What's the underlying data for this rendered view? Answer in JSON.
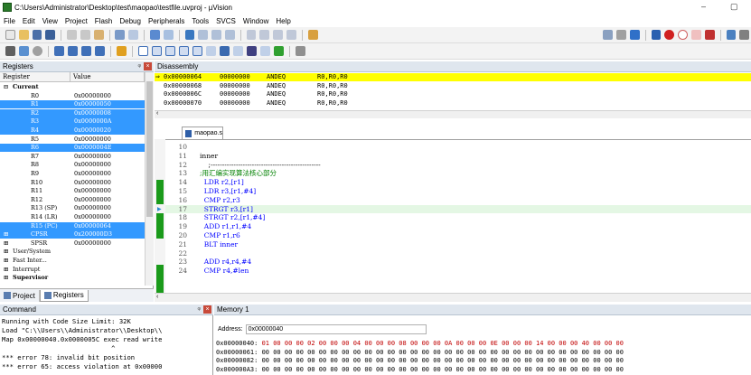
{
  "window": {
    "title": "C:\\Users\\Administrator\\Desktop\\test\\maopao\\testfile.uvproj - µVision",
    "minimize": "–",
    "restore": "▢"
  },
  "menu": [
    "File",
    "Edit",
    "View",
    "Project",
    "Flash",
    "Debug",
    "Peripherals",
    "Tools",
    "SVCS",
    "Window",
    "Help"
  ],
  "registers": {
    "header": "Registers",
    "col_register": "Register",
    "col_value": "Value",
    "rows": [
      {
        "tree": "⊟",
        "name": "Current",
        "value": "",
        "selected": false,
        "bold": true
      },
      {
        "tree": "",
        "name": "R0",
        "value": "0x00000000",
        "selected": false
      },
      {
        "tree": "",
        "name": "R1",
        "value": "0x00000050",
        "selected": true
      },
      {
        "tree": "",
        "name": "R2",
        "value": "0x00000008",
        "selected": true
      },
      {
        "tree": "",
        "name": "R3",
        "value": "0x0000000A",
        "selected": true
      },
      {
        "tree": "",
        "name": "R4",
        "value": "0x00000020",
        "selected": true
      },
      {
        "tree": "",
        "name": "R5",
        "value": "0x00000000",
        "selected": false
      },
      {
        "tree": "",
        "name": "R6",
        "value": "0x0000004E",
        "selected": true
      },
      {
        "tree": "",
        "name": "R7",
        "value": "0x00000000",
        "selected": false
      },
      {
        "tree": "",
        "name": "R8",
        "value": "0x00000000",
        "selected": false
      },
      {
        "tree": "",
        "name": "R9",
        "value": "0x00000000",
        "selected": false
      },
      {
        "tree": "",
        "name": "R10",
        "value": "0x00000000",
        "selected": false
      },
      {
        "tree": "",
        "name": "R11",
        "value": "0x00000000",
        "selected": false
      },
      {
        "tree": "",
        "name": "R12",
        "value": "0x00000000",
        "selected": false
      },
      {
        "tree": "",
        "name": "R13 (SP)",
        "value": "0x00000000",
        "selected": false
      },
      {
        "tree": "",
        "name": "R14 (LR)",
        "value": "0x00000000",
        "selected": false
      },
      {
        "tree": "",
        "name": "R15 (PC)",
        "value": "0x00000064",
        "selected": true
      },
      {
        "tree": "⊞",
        "name": "CPSR",
        "value": "0x200000D3",
        "selected": true
      },
      {
        "tree": "⊞",
        "name": "SPSR",
        "value": "0x00000000",
        "selected": false
      },
      {
        "tree": "⊞",
        "name": "User/System",
        "value": "",
        "selected": false,
        "indent": 0
      },
      {
        "tree": "⊞",
        "name": "Fast Inter...",
        "value": "",
        "selected": false,
        "indent": 0
      },
      {
        "tree": "⊞",
        "name": "Interrupt",
        "value": "",
        "selected": false,
        "indent": 0
      },
      {
        "tree": "⊞",
        "name": "Supervisor",
        "value": "",
        "selected": false,
        "indent": 0,
        "bold": true
      }
    ],
    "tabs": [
      "Project",
      "Registers"
    ]
  },
  "disassembly": {
    "header": "Disassembly",
    "lines": [
      {
        "addr": "0x00000064",
        "op": "00000000",
        "mn": "ANDEQ",
        "args": "R0,R0,R0",
        "current": true
      },
      {
        "addr": "0x00000068",
        "op": "00000000",
        "mn": "ANDEQ",
        "args": "R0,R0,R0",
        "current": false
      },
      {
        "addr": "0x0000006C",
        "op": "00000000",
        "mn": "ANDEQ",
        "args": "R0,R0,R0",
        "current": false
      },
      {
        "addr": "0x00000070",
        "op": "00000000",
        "mn": "ANDEQ",
        "args": "R0,R0,R0",
        "current": false
      }
    ]
  },
  "editor": {
    "tab": "maopao.s",
    "lines": [
      {
        "n": "10",
        "code": ""
      },
      {
        "n": "11",
        "code": "inner"
      },
      {
        "n": "12",
        "code": "    ;------------------------------------------------"
      },
      {
        "n": "13",
        "code": ";用汇编实现算法核心部分",
        "comment": true
      },
      {
        "n": "14",
        "code": "  LDR r2,[r1]"
      },
      {
        "n": "15",
        "code": "  LDR r3,[r1,#4]"
      },
      {
        "n": "16",
        "code": "  CMP r2,r3"
      },
      {
        "n": "17",
        "code": "  STRGT r3,[r1]",
        "hl": true
      },
      {
        "n": "18",
        "code": "  STRGT r2,[r1,#4]"
      },
      {
        "n": "19",
        "code": "  ADD r1,r1,#4"
      },
      {
        "n": "20",
        "code": "  CMP r1,r6"
      },
      {
        "n": "21",
        "code": "  BLT inner"
      },
      {
        "n": "22",
        "code": ""
      },
      {
        "n": "23",
        "code": "  ADD r4,r4,#4"
      },
      {
        "n": "24",
        "code": "  CMP r4,#len"
      }
    ]
  },
  "command": {
    "header": "Command",
    "lines": [
      "Running with Code Size Limit: 32K",
      "Load \"C:\\\\Users\\\\Administrator\\\\Desktop\\\\",
      "Map 0x00000040.0x0000005C exec read write",
      "                            ^",
      "*** error 78: invalid bit position",
      "*** error 65: access violation at 0x00000"
    ]
  },
  "memory": {
    "header": "Memory 1",
    "address_label": "Address:",
    "address_value": "0x00000040",
    "lines": [
      {
        "addr": "0x00000040:",
        "bytes": "01 00 00 00 02 00 00 00 04 00 00 00 08 00 00 00 0A 00 00 00 0E 00 00 00 14 00 00 00 40 00 00 00",
        "red": true
      },
      {
        "addr": "0x00000061:",
        "bytes": "00 00 00 00 00 00 00 00 00 00 00 00 00 00 00 00 00 00 00 00 00 00 00 00 00 00 00 00 00 00 00 00",
        "red": false
      },
      {
        "addr": "0x00000082:",
        "bytes": "00 00 00 00 00 00 00 00 00 00 00 00 00 00 00 00 00 00 00 00 00 00 00 00 00 00 00 00 00 00 00 00",
        "red": false
      },
      {
        "addr": "0x000000A3:",
        "bytes": "00 00 00 00 00 00 00 00 00 00 00 00 00 00 00 00 00 00 00 00 00 00 00 00 00 00 00 00 00 00 00 00",
        "red": false
      }
    ]
  }
}
